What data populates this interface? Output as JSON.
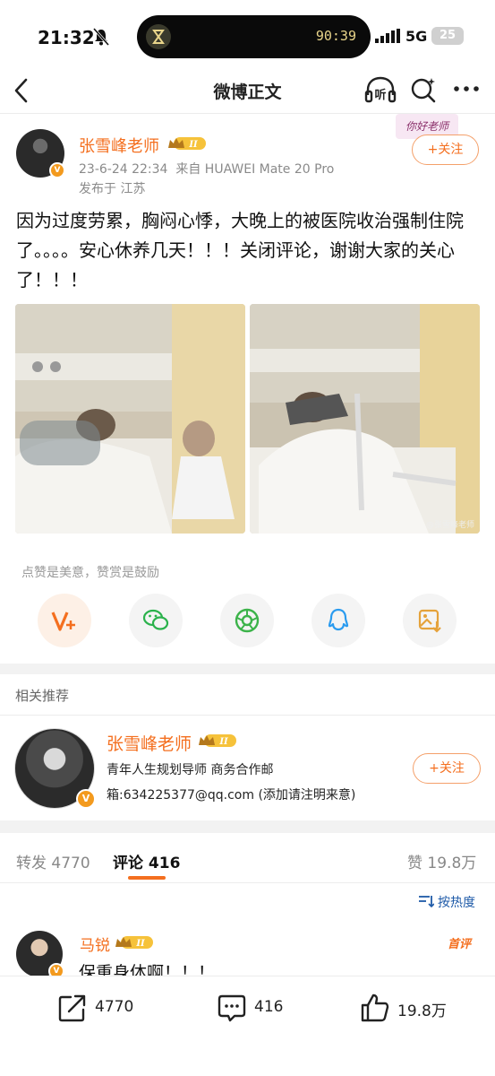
{
  "status_bar": {
    "time": "21:32",
    "timer": "90:39",
    "network": "5G",
    "battery": "25"
  },
  "nav": {
    "title": "微博正文",
    "listen_label": "听"
  },
  "post": {
    "author": "张雪峰老师",
    "level": "II",
    "date": "23-6-24 22:34",
    "source_prefix": "来自",
    "source": "HUAWEI Mate 20 Pro",
    "location": "发布于 江苏",
    "follow_label": "+关注",
    "sticker": "你好老师",
    "text": "因为过度劳累，胸闷心悸，大晚上的被医院收治强制住院了。。。。安心休养几天！！！关闭评论，谢谢大家的关心了！！！",
    "watermark": "@张雪峰老师"
  },
  "reward_tip": "点赞是美意，赞赏是鼓励",
  "share_icons": [
    "like-v-icon",
    "wechat-icon",
    "moments-icon",
    "qq-icon",
    "save-image-icon"
  ],
  "related": {
    "title": "相关推荐",
    "name": "张雪峰老师",
    "level": "II",
    "line1": "青年人生规划导师 商务合作邮",
    "line2": "箱:634225377@qq.com (添加请注明来意)",
    "follow_label": "+关注"
  },
  "tabs": {
    "repost_label": "转发",
    "repost_count": "4770",
    "comment_label": "评论",
    "comment_count": "416",
    "like_label": "赞",
    "like_count": "19.8万"
  },
  "sort_label": "按热度",
  "comment": {
    "author": "马锐",
    "level": "II",
    "badge": "首评",
    "text": "保重身体啊！！！"
  },
  "bottom_bar": {
    "repost": "4770",
    "comment": "416",
    "like": "19.8万"
  },
  "colors": {
    "accent": "#f46f1f",
    "link": "#1e5aa8"
  }
}
